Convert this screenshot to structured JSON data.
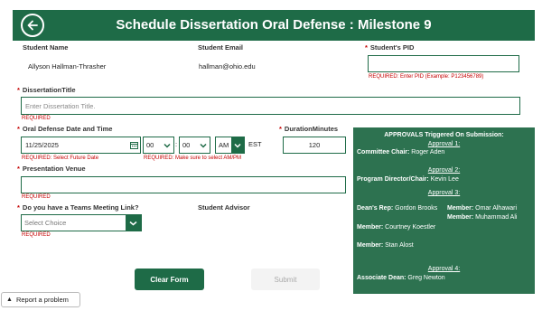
{
  "header": {
    "title": "Schedule Dissertation Oral Defense : Milestone 9"
  },
  "student": {
    "name_label": "Student Name",
    "name_value": "Allyson Hallman-Thrasher",
    "email_label": "Student Email",
    "email_value": "hallman@ohio.edu",
    "pid_label": "Student's PID",
    "pid_value": "",
    "pid_error": "REQUIRED: Enter PID (Example: P123456789)"
  },
  "dissertation": {
    "label": "DissertationTitle",
    "placeholder": "Enter Dissertation Title.",
    "error": "REQUIRED"
  },
  "defense": {
    "label": "Oral Defense Date and Time",
    "date": "11/25/2025",
    "hour": "00",
    "minute": "00",
    "ampm": "AM",
    "tz": "EST",
    "date_error": "REQUIRED: Select Future Date",
    "time_error": "REQUIRED: Make sure to select AM/PM"
  },
  "duration": {
    "label": "DurationMinutes",
    "value": "120"
  },
  "venue": {
    "label": "Presentation Venue",
    "value": "",
    "error": "REQUIRED"
  },
  "teams": {
    "label": "Do you have a Teams Meeting Link?",
    "placeholder": "Select Choice",
    "error": "REQUIRED"
  },
  "advisor": {
    "label": "Student Advisor"
  },
  "approvals": {
    "title": "APPROVALS Triggered On Submission:",
    "a1": {
      "head": "Approval 1:",
      "role": "Committee Chair:",
      "name": "Roger Aden"
    },
    "a2": {
      "head": "Approval 2:",
      "role": "Program Director/Chair:",
      "name": "Kevin Lee"
    },
    "a3": {
      "head": "Approval 3:",
      "deans_rep_role": "Dean's Rep:",
      "deans_rep_name": "Gordon Brooks",
      "m1_role": "Member:",
      "m1_name": "Courtney Koestler",
      "m2_role": "Member:",
      "m2_name": "Stan Alost",
      "m3_role": "Member:",
      "m3_name": "Omar Alhawari",
      "m4_role": "Member:",
      "m4_name": "Muhammad Ali"
    },
    "a4": {
      "head": "Approval 4:",
      "role": "Associate Dean:",
      "name": "Greg Newton"
    }
  },
  "buttons": {
    "clear": "Clear Form",
    "submit": "Submit"
  },
  "report": {
    "label": "Report a problem"
  },
  "colors": {
    "accent": "#1e6b47",
    "panel": "#2d7250",
    "error": "#c40000"
  },
  "icons": [
    "back-arrow-icon",
    "calendar-icon",
    "chevron-down-icon",
    "warning-icon"
  ]
}
